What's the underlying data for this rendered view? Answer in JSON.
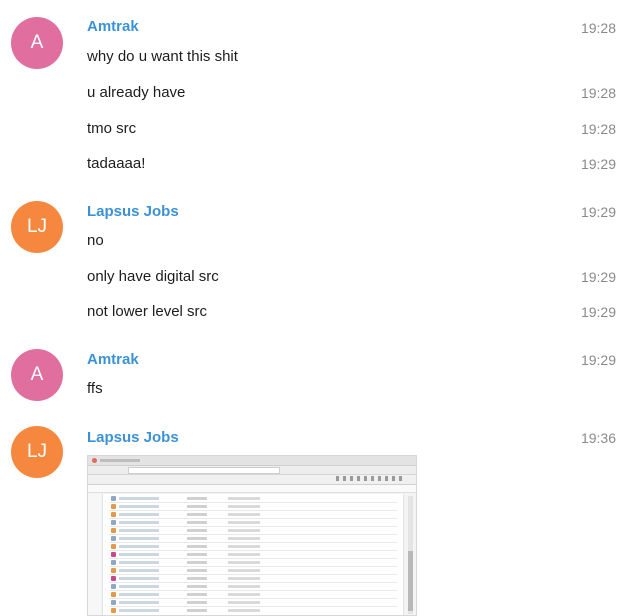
{
  "messages": [
    {
      "avatar": "A",
      "sender": "Amtrak",
      "time": "19:28",
      "text": "why do u want this shit"
    },
    {
      "text": "u already have",
      "time": "19:28"
    },
    {
      "text": "tmo src",
      "time": "19:28"
    },
    {
      "text": "tadaaaa!",
      "time": "19:29"
    },
    {
      "avatar": "LJ",
      "sender": "Lapsus Jobs",
      "time": "19:29",
      "text": "no"
    },
    {
      "text": "only have digital src",
      "time": "19:29"
    },
    {
      "text": "not lower level src",
      "time": "19:29"
    },
    {
      "avatar": "A",
      "sender": "Amtrak",
      "time": "19:29",
      "text": "ffs"
    },
    {
      "avatar": "LJ",
      "sender": "Lapsus Jobs",
      "time": "19:36",
      "attachment": "image"
    }
  ],
  "colors": {
    "amtrak_avatar": "#e06fa0",
    "lapsus_avatar": "#f5883e",
    "sender_name": "#3d92d6",
    "timestamp": "#8a8a8a"
  }
}
